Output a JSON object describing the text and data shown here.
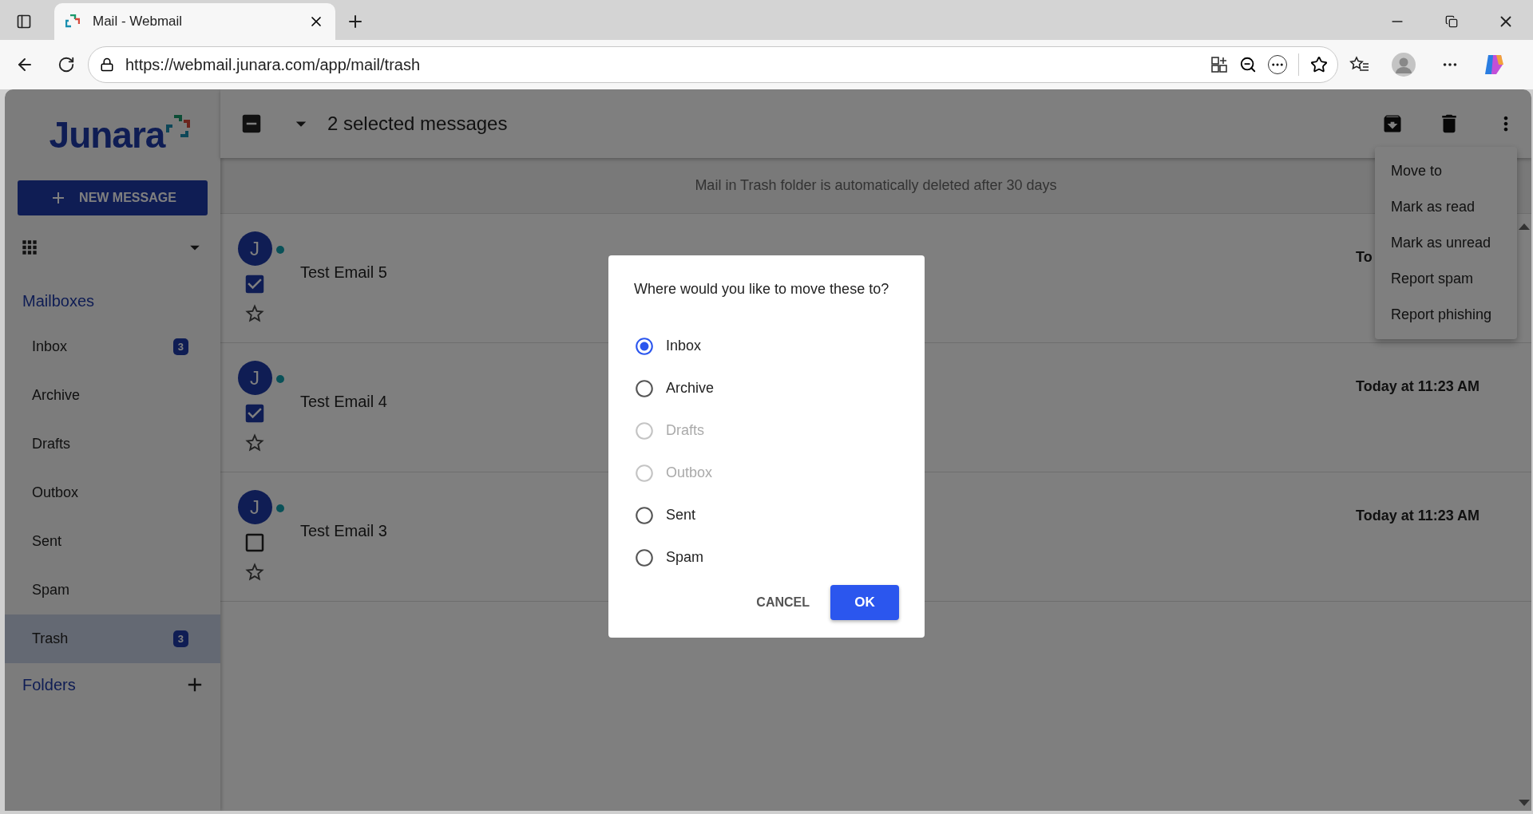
{
  "browser": {
    "tab_title": "Mail - Webmail",
    "url": "https://webmail.junara.com/app/mail/trash"
  },
  "sidebar": {
    "logo": "Junara",
    "new_message": "NEW MESSAGE",
    "mailboxes_heading": "Mailboxes",
    "folders_heading": "Folders",
    "mailboxes": [
      {
        "name": "Inbox",
        "count": "3",
        "selected": false
      },
      {
        "name": "Archive",
        "selected": false
      },
      {
        "name": "Drafts",
        "selected": false
      },
      {
        "name": "Outbox",
        "selected": false
      },
      {
        "name": "Sent",
        "selected": false
      },
      {
        "name": "Spam",
        "selected": false
      },
      {
        "name": "Trash",
        "count": "3",
        "selected": true
      }
    ]
  },
  "toolbar": {
    "indeterminate": true,
    "selection_label": "2 selected messages"
  },
  "notice": "Mail in Trash folder is automatically deleted after 30 days",
  "messages": [
    {
      "avatar": "J",
      "unread": true,
      "checked": true,
      "starred": false,
      "subject": "Test Email 5",
      "date": "To"
    },
    {
      "avatar": "J",
      "unread": true,
      "checked": true,
      "starred": false,
      "subject": "Test Email 4",
      "date": "Today at 11:23 AM"
    },
    {
      "avatar": "J",
      "unread": true,
      "checked": false,
      "starred": false,
      "subject": "Test Email 3",
      "date": "Today at 11:23 AM"
    }
  ],
  "menu": [
    "Move to",
    "Mark as read",
    "Mark as unread",
    "Report spam",
    "Report phishing"
  ],
  "dialog": {
    "question": "Where would you like to move these to?",
    "options": [
      {
        "label": "Inbox",
        "selected": true,
        "disabled": false
      },
      {
        "label": "Archive",
        "selected": false,
        "disabled": false
      },
      {
        "label": "Drafts",
        "selected": false,
        "disabled": true
      },
      {
        "label": "Outbox",
        "selected": false,
        "disabled": true
      },
      {
        "label": "Sent",
        "selected": false,
        "disabled": false
      },
      {
        "label": "Spam",
        "selected": false,
        "disabled": false
      }
    ],
    "cancel": "CANCEL",
    "ok": "OK"
  }
}
